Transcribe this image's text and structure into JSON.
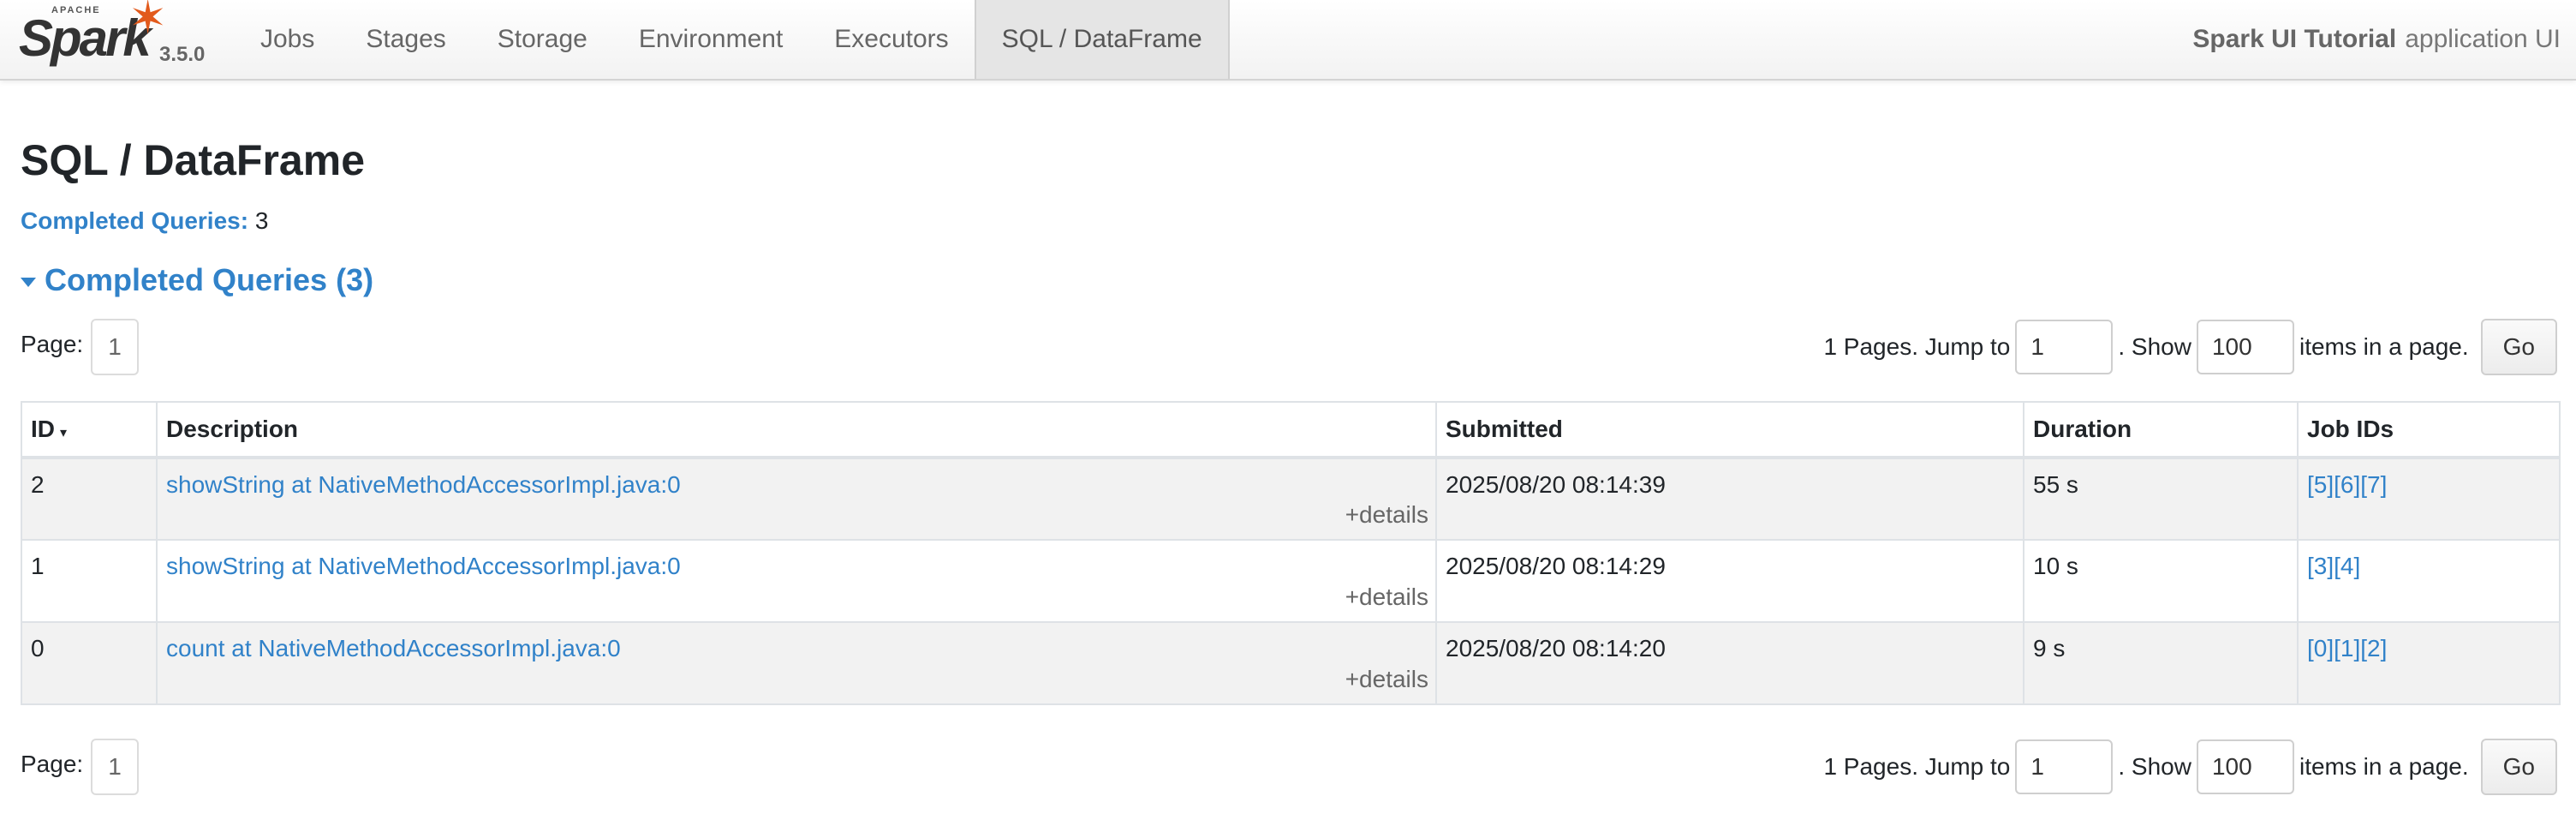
{
  "brand": {
    "apache": "APACHE",
    "name": "Spark",
    "version": "3.5.0",
    "star_icon": "spark-star-icon",
    "accent": "#e25a1c"
  },
  "nav": {
    "tabs": [
      "Jobs",
      "Stages",
      "Storage",
      "Environment",
      "Executors",
      "SQL / DataFrame"
    ],
    "active": "SQL / DataFrame"
  },
  "app": {
    "name": "Spark UI Tutorial",
    "suffix": "application UI"
  },
  "page": {
    "title": "SQL / DataFrame",
    "summary_label": "Completed Queries:",
    "summary_value": "3",
    "section_title": "Completed Queries (3)"
  },
  "pager": {
    "page_label": "Page:",
    "current_page": "1",
    "pages_text": "1 Pages. Jump to",
    "jump_value": "1",
    "show_text": ". Show",
    "page_size": "100",
    "items_text": "items in a page.",
    "go_label": "Go"
  },
  "table": {
    "headers": {
      "id": "ID",
      "id_sort": "▾",
      "description": "Description",
      "submitted": "Submitted",
      "duration": "Duration",
      "job_ids": "Job IDs"
    },
    "details_label": "+details",
    "rows": [
      {
        "id": "2",
        "description": "showString at NativeMethodAccessorImpl.java:0",
        "submitted": "2025/08/20 08:14:39",
        "duration": "55 s",
        "jobs": [
          "[5]",
          "[6]",
          "[7]"
        ]
      },
      {
        "id": "1",
        "description": "showString at NativeMethodAccessorImpl.java:0",
        "submitted": "2025/08/20 08:14:29",
        "duration": "10 s",
        "jobs": [
          "[3]",
          "[4]"
        ]
      },
      {
        "id": "0",
        "description": "count at NativeMethodAccessorImpl.java:0",
        "submitted": "2025/08/20 08:14:20",
        "duration": "9 s",
        "jobs": [
          "[0]",
          "[1]",
          "[2]"
        ]
      }
    ]
  },
  "colors": {
    "link": "#3182c9",
    "row_alt": "#f2f2f2",
    "nav_active": "#e5e5e5"
  }
}
